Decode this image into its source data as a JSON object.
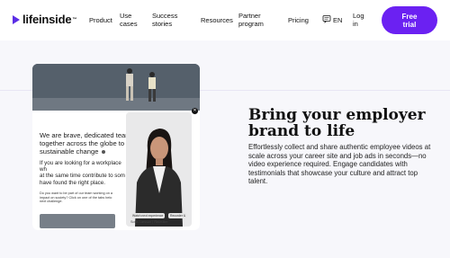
{
  "header": {
    "logo_text": "lifeinside",
    "logo_tm": "™",
    "nav": {
      "product": "Product",
      "use_cases_1": "Use",
      "use_cases_2": "cases",
      "success_1": "Success",
      "success_2": "stories",
      "resources": "Resources",
      "partner_1": "Partner",
      "partner_2": "program",
      "pricing": "Pricing"
    },
    "language": "EN",
    "login_1": "Log",
    "login_2": "in",
    "cta_1": "Free",
    "cta_2": "trial",
    "accent": "#6b21f2"
  },
  "preview": {
    "headline_1": "We are brave, dedicated team",
    "headline_2": "together across the globe to",
    "headline_3": "sustainable change",
    "para_1": "If you are looking for a workplace wh",
    "para_2": "at the same time contribute to som",
    "para_3": "have found the right place.",
    "small_1": "Do you want to be part of our team working on a",
    "small_2": "impact on society? Click on one of the tabs belo",
    "small_3": "next challenge.",
    "video_btn_1": "Watch next experience",
    "video_btn_2": "Recorder &",
    "video_name": "Sofia Larsson | Recruiter"
  },
  "hero": {
    "title_1": "Bring your employer",
    "title_2": "brand to life",
    "description": "Effortlessly collect and share authentic employee videos at scale across your career site and job ads in seconds—no video experience required. Engage candidates with testimonials that showcase your culture and attract top talent."
  },
  "icons": {
    "language": "globe-chat-icon",
    "logo": "play-triangle-icon",
    "close": "close-icon"
  }
}
